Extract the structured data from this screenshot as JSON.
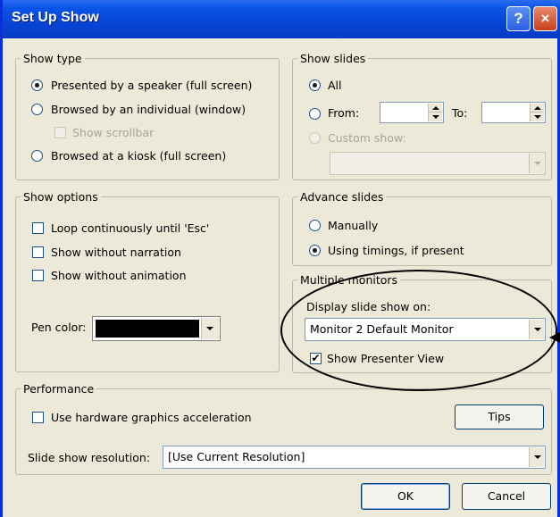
{
  "window": {
    "title": "Set Up Show",
    "help_label": "?",
    "close_label": "×"
  },
  "show_type": {
    "legend": "Show type",
    "speaker": "Presented by a speaker (full screen)",
    "individual": "Browsed by an individual (window)",
    "scrollbar": "Show scrollbar",
    "kiosk": "Browsed at a kiosk (full screen)",
    "selected": "speaker"
  },
  "show_slides": {
    "legend": "Show slides",
    "all": "All",
    "from": "From:",
    "to": "To:",
    "from_value": "",
    "to_value": "",
    "custom": "Custom show:",
    "custom_value": "",
    "selected": "all"
  },
  "show_options": {
    "legend": "Show options",
    "loop": "Loop continuously until 'Esc'",
    "narration": "Show without narration",
    "animation": "Show without animation",
    "pen_label": "Pen color:",
    "pen_color": "#000000"
  },
  "advance": {
    "legend": "Advance slides",
    "manually": "Manually",
    "timings": "Using timings, if present",
    "selected": "timings"
  },
  "monitors": {
    "legend": "Multiple monitors",
    "display_label": "Display slide show on:",
    "display_value": "Monitor 2 Default Monitor",
    "presenter_label": "Show Presenter View",
    "presenter_checked": true,
    "presenter_mark": "✔"
  },
  "performance": {
    "legend": "Performance",
    "hardware": "Use hardware graphics acceleration",
    "tips": "Tips",
    "resolution_label": "Slide show resolution:",
    "resolution_value": "[Use Current Resolution]"
  },
  "footer": {
    "ok": "OK",
    "cancel": "Cancel"
  },
  "colors": {
    "title_bar": "#0a55e6",
    "dialog_bg": "#ece9d8",
    "annotation": "#000000"
  }
}
